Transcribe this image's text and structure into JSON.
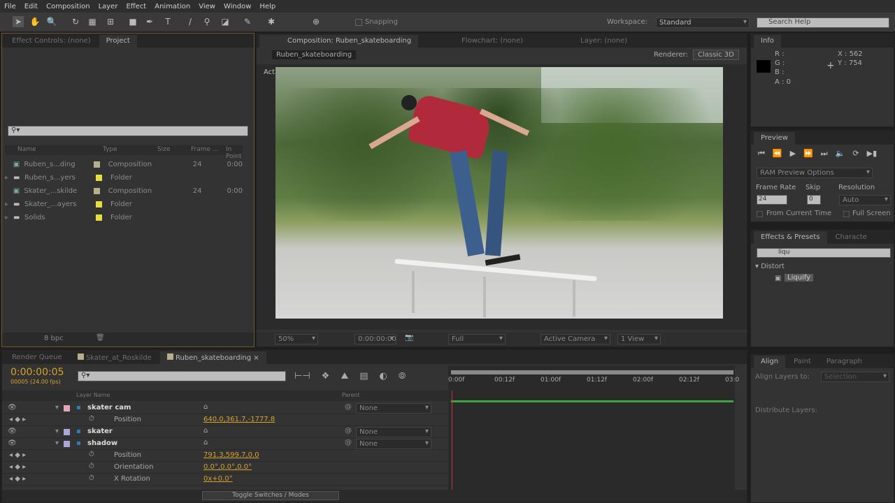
{
  "menu": [
    "File",
    "Edit",
    "Composition",
    "Layer",
    "Effect",
    "Animation",
    "View",
    "Window",
    "Help"
  ],
  "toolbar": {
    "snapping": "Snapping",
    "workspace_label": "Workspace:",
    "workspace": "Standard",
    "search_placeholder": "Search Help"
  },
  "project": {
    "tabs": [
      "Effect Controls: (none)",
      "Project"
    ],
    "columns": [
      "Name",
      "Type",
      "Size",
      "Frame ...",
      "In Point"
    ],
    "items": [
      {
        "name": "Ruben_s...ding",
        "type": "Composition",
        "frame": "24",
        "in": "0:00",
        "kind": "comp",
        "label": "#b8ae8c"
      },
      {
        "name": "Ruben_s...yers",
        "type": "Folder",
        "frame": "",
        "in": "",
        "kind": "folder",
        "label": "#e6de3c"
      },
      {
        "name": "Skater_...skilde",
        "type": "Composition",
        "frame": "24",
        "in": "0:00",
        "kind": "comp",
        "label": "#b8ae8c"
      },
      {
        "name": "Skater_...ayers",
        "type": "Folder",
        "frame": "",
        "in": "",
        "kind": "folder",
        "label": "#e6de3c"
      },
      {
        "name": "Solids",
        "type": "Folder",
        "frame": "",
        "in": "",
        "kind": "folder",
        "label": "#e6de3c"
      }
    ],
    "bpc": "8 bpc"
  },
  "comp": {
    "tabs": [
      "Composition: Ruben_skateboarding",
      "Flowchart: (none)",
      "Layer: (none)"
    ],
    "crumb": "Ruben_skateboarding",
    "renderer_label": "Renderer:",
    "renderer": "Classic 3D",
    "view_label": "Active Camera",
    "footer": {
      "zoom": "50%",
      "timecode": "0:00:00:00",
      "resolution": "Full",
      "camera": "Active Camera",
      "views": "1 View"
    }
  },
  "info": {
    "tab": "Info",
    "r": "R :",
    "g": "G :",
    "b": "B :",
    "a": "A : 0",
    "x": "X : 562",
    "y": "Y : 754"
  },
  "preview": {
    "tab": "Preview",
    "ram": "RAM Preview Options",
    "frame_rate_label": "Frame Rate",
    "frame_rate": "24",
    "skip_label": "Skip",
    "skip": "0",
    "resolution_label": "Resolution",
    "resolution": "Auto",
    "from_current": "From Current Time",
    "full_screen": "Full Screen"
  },
  "effects": {
    "tabs": [
      "Effects & Presets",
      "Characte"
    ],
    "search": "liqu",
    "category": "Distort",
    "item": "Liquify"
  },
  "align": {
    "tabs": [
      "Align",
      "Paint",
      "Paragraph"
    ],
    "align_to_label": "Align Layers to:",
    "align_to": "Selection",
    "distribute": "Distribute Layers:"
  },
  "timeline": {
    "tabs": [
      "Render Queue",
      "Skater_at_Roskilde",
      "Ruben_skateboarding"
    ],
    "timecode": "0:00:00:05",
    "frames": "00005 (24.00 fps)",
    "col_layer": "Layer Name",
    "col_parent": "Parent",
    "ruler": [
      "0:00f",
      "00:12f",
      "01:00f",
      "01:12f",
      "02:00f",
      "02:12f",
      "03:0"
    ],
    "rows": [
      {
        "name": "skater cam",
        "type": "layer",
        "parent": "None",
        "color": "#e0a8b8"
      },
      {
        "name": "Position",
        "type": "prop",
        "value": "640.0,361.7,-1777.8"
      },
      {
        "name": "skater",
        "type": "layer",
        "parent": "None",
        "color": "#a8a8d8"
      },
      {
        "name": "shadow",
        "type": "layer",
        "parent": "None",
        "color": "#a8a8d8"
      },
      {
        "name": "Position",
        "type": "prop",
        "value": "791.3,599.7,0.0"
      },
      {
        "name": "Orientation",
        "type": "prop",
        "value": "0.0°,0.0°,0.0°"
      },
      {
        "name": "X Rotation",
        "type": "prop",
        "value": "0x+0.0°"
      }
    ],
    "toggle": "Toggle Switches / Modes"
  }
}
